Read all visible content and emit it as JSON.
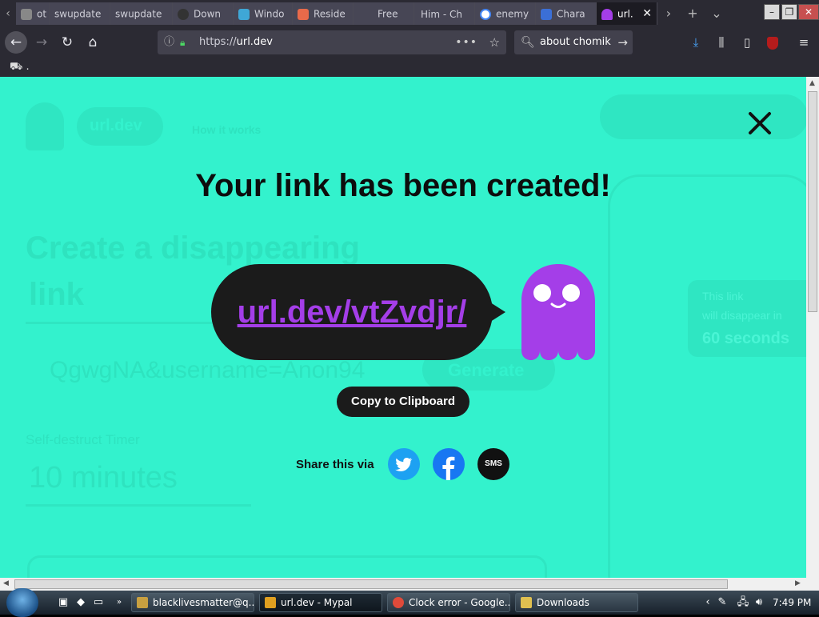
{
  "browser": {
    "tabs": [
      {
        "title": "ot m",
        "favicon_color": "#888888"
      },
      {
        "title": "swupdate",
        "favicon_color": ""
      },
      {
        "title": "swupdate",
        "favicon_color": ""
      },
      {
        "title": "Down",
        "favicon_color": "#333333"
      },
      {
        "title": "Windo",
        "favicon_color": "#3fa7d6"
      },
      {
        "title": "Reside",
        "favicon_color": "#e86a4a"
      },
      {
        "title": "Free",
        "favicon_color": "#5a7ad6"
      },
      {
        "title": "Him - Ch",
        "favicon_color": ""
      },
      {
        "title": "enemy",
        "favicon_color": "#4285f4"
      },
      {
        "title": "Chara",
        "favicon_color": "#3b6fd6"
      },
      {
        "title": "url.",
        "favicon_color": "#a43ee8"
      }
    ],
    "url": {
      "scheme": "https://",
      "host": "url.dev"
    },
    "search_query": "about chomik",
    "bookmark_label": "."
  },
  "page": {
    "background_ghost": {
      "logo": "url.dev",
      "nav": "How it works",
      "heading_line1": "Create a disappearing",
      "heading_line2": "link",
      "input_value": "QgwgNA&username=Anon94",
      "generate": "Generate",
      "timer_label": "Self-destruct Timer",
      "timer_value": "10 minutes",
      "phone_msg1": "This link",
      "phone_msg2": "will disappear in",
      "phone_msg3": "60 seconds"
    },
    "modal": {
      "title": "Your link has been created!",
      "short_link": "url.dev/vtZvdjr/",
      "copy_button": "Copy to Clipboard",
      "share_label": "Share this via",
      "sms_label": "SMS"
    },
    "colors": {
      "accent": "#33f2cd",
      "link": "#a43ee8",
      "dark": "#1b1b1b"
    }
  },
  "taskbar": {
    "tasks": [
      {
        "label": "blacklivesmatter@q...",
        "icon_color": "#c8a040"
      },
      {
        "label": "url.dev - Mypal",
        "icon_color": "#e0a020"
      },
      {
        "label": "Clock error - Google...",
        "icon_color": "#e04a3a"
      },
      {
        "label": "Downloads",
        "icon_color": "#e0c050"
      }
    ],
    "clock": "7:49 PM"
  }
}
